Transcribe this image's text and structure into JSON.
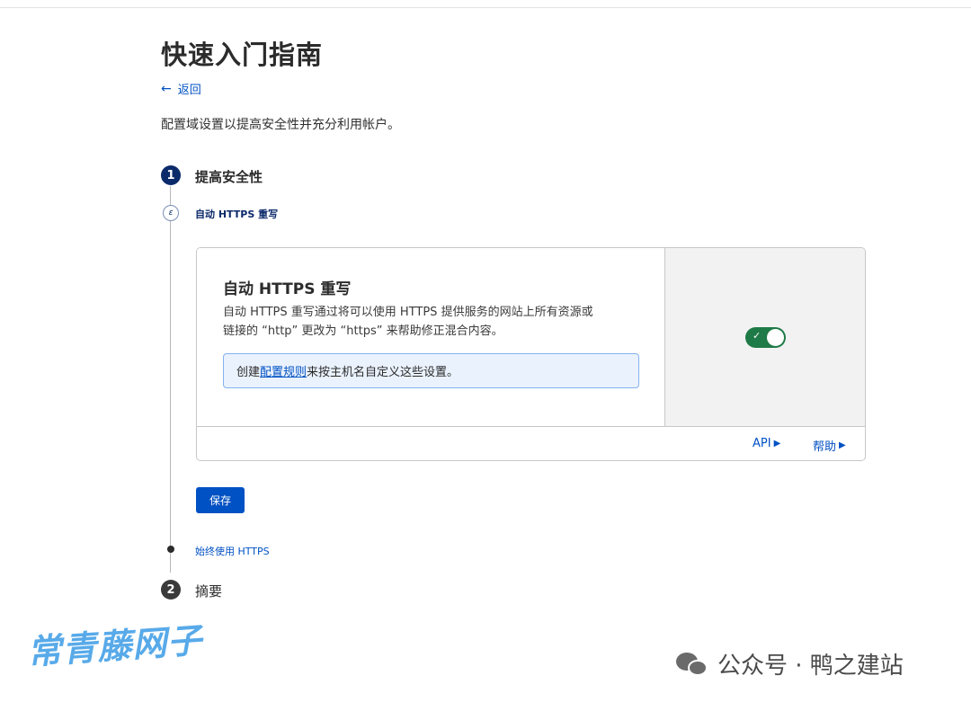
{
  "page": {
    "title": "快速入门指南",
    "back_label": "返回",
    "intro": "配置域设置以提高安全性并充分利用帐户。"
  },
  "steps": [
    {
      "number": "1",
      "title": "提高安全性"
    },
    {
      "number": "2",
      "title": "摘要"
    }
  ],
  "substeps": {
    "current": "自动 HTTPS 重写",
    "next": "始终使用 HTTPS"
  },
  "card": {
    "title": "自动 HTTPS 重写",
    "description_line1": "自动 HTTPS 重写通过将可以使用 HTTPS 提供服务的网站上所有资源或",
    "description_line2": "链接的 “http” 更改为 “https” 来帮助修正混合内容。",
    "info_prefix": "创建",
    "info_link": "配置规则",
    "info_suffix": "来按主机名自定义这些设置。",
    "toggle_on": true,
    "toggle_check": "✓",
    "api_label": "API",
    "help_label": "帮助"
  },
  "save_label": "保存",
  "watermarks": {
    "left": "常青藤网子",
    "right": "公众号 · 鸭之建站"
  },
  "colors": {
    "accent": "#0051c3",
    "step_active": "#0b2a6a",
    "toggle_on": "#1e7a46"
  }
}
